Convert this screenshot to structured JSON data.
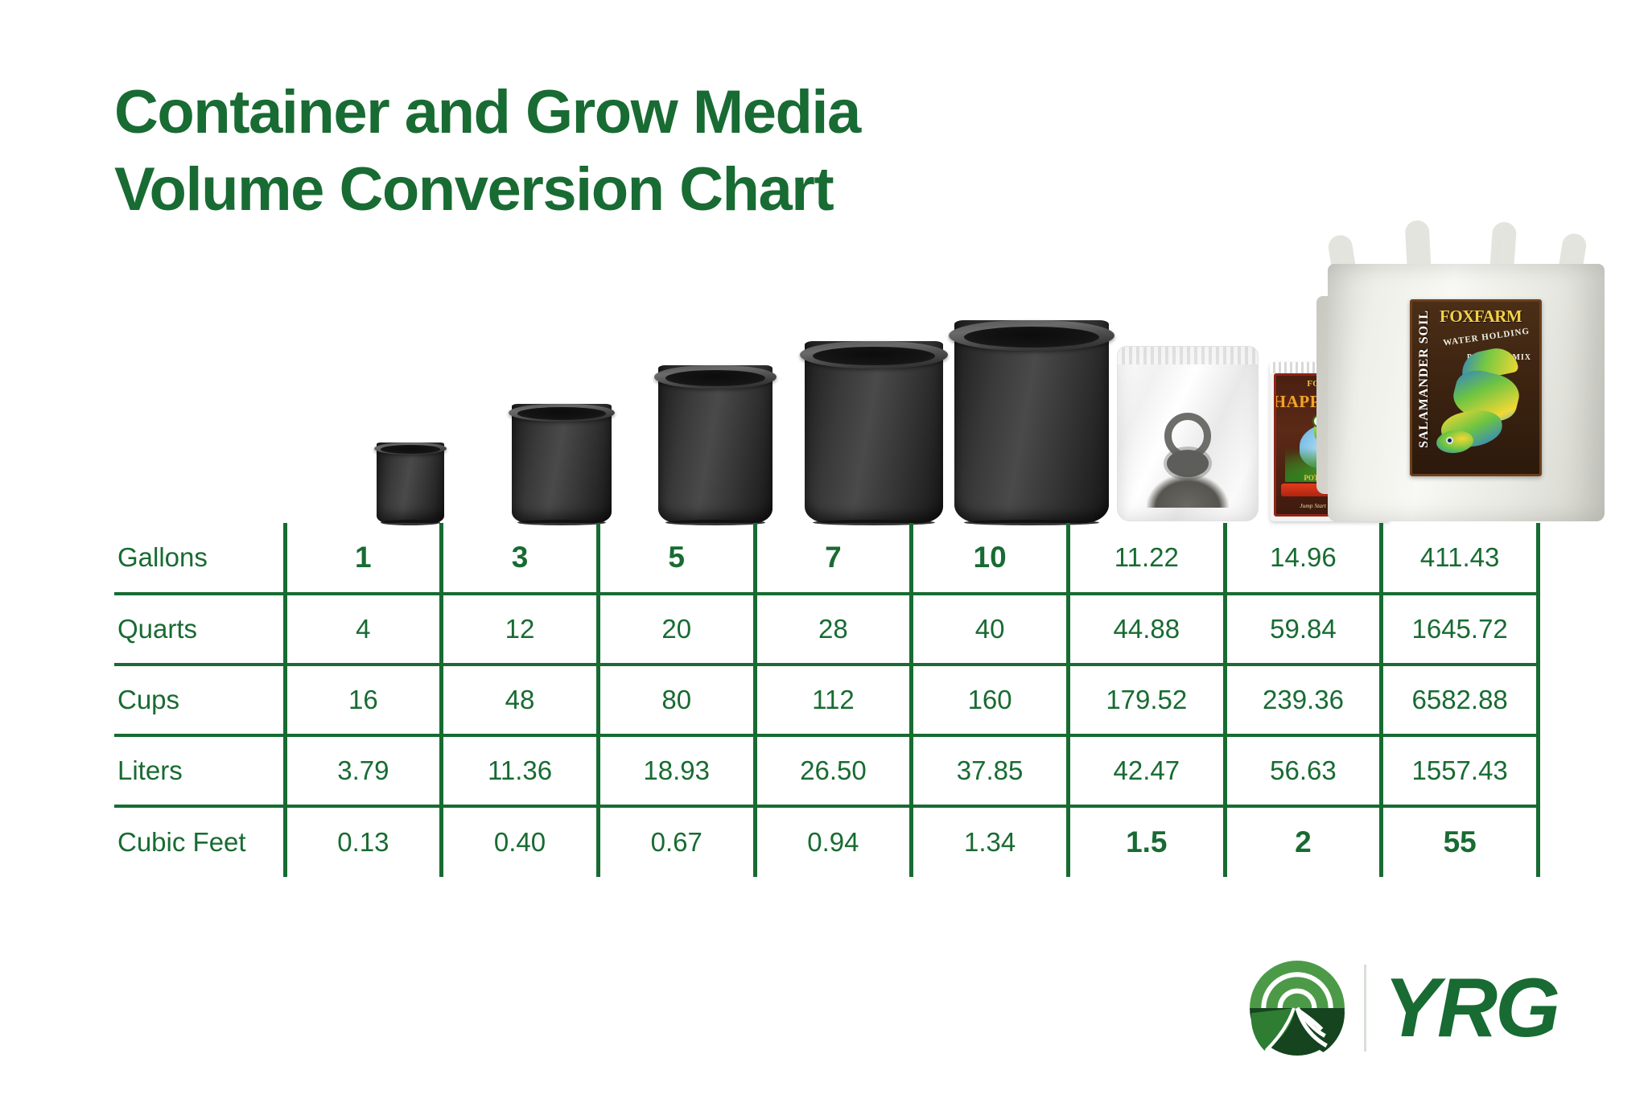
{
  "theme": {
    "brand_green": "#186B32",
    "background": "#ffffff"
  },
  "title": {
    "line1": "Container and Grow Media",
    "line2": "Volume Conversion Chart"
  },
  "products": [
    {
      "name": "1 gallon nursery pot",
      "type": "pot"
    },
    {
      "name": "3 gallon nursery pot",
      "type": "pot"
    },
    {
      "name": "5 gallon nursery pot",
      "type": "pot"
    },
    {
      "name": "7 gallon nursery pot",
      "type": "pot"
    },
    {
      "name": "10 gallon nursery pot",
      "type": "pot"
    },
    {
      "name": "1.5 cubic foot bag of grow media",
      "type": "poly-bag"
    },
    {
      "name": "FoxFarm Happy Frog potting soil bag",
      "type": "happy-frog-bag"
    },
    {
      "name": "FoxFarm Salamander Soil bulk tote",
      "type": "bulk-tote"
    }
  ],
  "packaging": {
    "happy_frog": {
      "brand": "FOXFARM",
      "product": "HAPPY FROG",
      "subtitle": "POTTING SOIL",
      "tagline": "Jump Start Your Garden!"
    },
    "salamander": {
      "brand": "FOXFARM",
      "product": "SALAMANDER SOIL",
      "feature": "WATER HOLDING",
      "subtitle": "POTTING MIX"
    }
  },
  "chart_data": {
    "type": "table",
    "title": "Container and Grow Media Volume Conversion Chart",
    "row_header_label": "",
    "columns": [
      {
        "key": "c1",
        "emphasis": true
      },
      {
        "key": "c2",
        "emphasis": true
      },
      {
        "key": "c3",
        "emphasis": true
      },
      {
        "key": "c4",
        "emphasis": true
      },
      {
        "key": "c5",
        "emphasis": true
      },
      {
        "key": "c6",
        "emphasis": false
      },
      {
        "key": "c7",
        "emphasis": false
      },
      {
        "key": "c8",
        "emphasis": false
      }
    ],
    "rows": [
      {
        "label": "Gallons",
        "values": [
          "1",
          "3",
          "5",
          "7",
          "10",
          "11.22",
          "14.96",
          "411.43"
        ],
        "bold": [
          true,
          true,
          true,
          true,
          true,
          false,
          false,
          false
        ]
      },
      {
        "label": "Quarts",
        "values": [
          "4",
          "12",
          "20",
          "28",
          "40",
          "44.88",
          "59.84",
          "1645.72"
        ],
        "bold": [
          false,
          false,
          false,
          false,
          false,
          false,
          false,
          false
        ]
      },
      {
        "label": "Cups",
        "values": [
          "16",
          "48",
          "80",
          "112",
          "160",
          "179.52",
          "239.36",
          "6582.88"
        ],
        "bold": [
          false,
          false,
          false,
          false,
          false,
          false,
          false,
          false
        ]
      },
      {
        "label": "Liters",
        "values": [
          "3.79",
          "11.36",
          "18.93",
          "26.50",
          "37.85",
          "42.47",
          "56.63",
          "1557.43"
        ],
        "bold": [
          false,
          false,
          false,
          false,
          false,
          false,
          false,
          false
        ]
      },
      {
        "label": "Cubic Feet",
        "values": [
          "0.13",
          "0.40",
          "0.67",
          "0.94",
          "1.34",
          "1.5",
          "2",
          "55"
        ],
        "bold": [
          false,
          false,
          false,
          false,
          false,
          true,
          true,
          true
        ]
      }
    ]
  },
  "logo": {
    "wordmark": "YRG",
    "emblem_name": "field-and-sun-emblem"
  }
}
